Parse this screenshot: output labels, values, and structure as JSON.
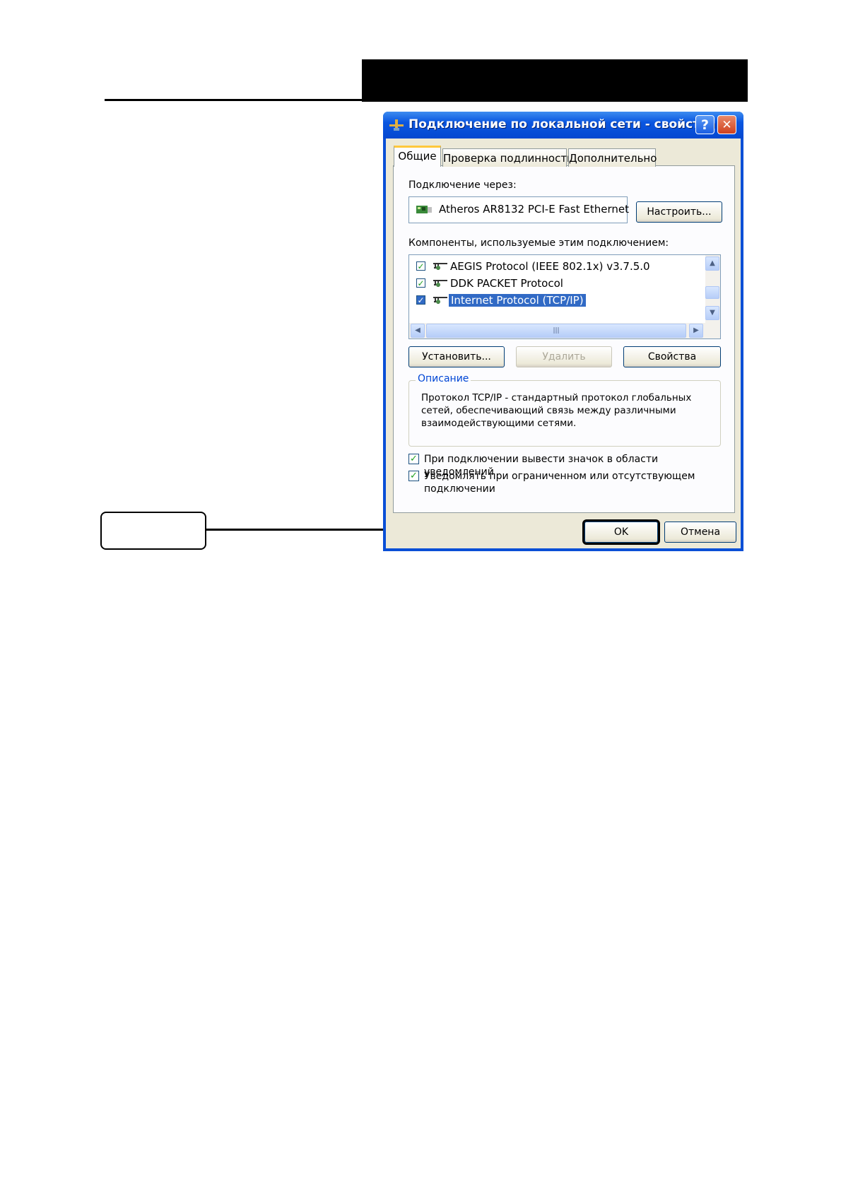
{
  "window": {
    "title": "Подключение по локальной сети - свойства",
    "help_label": "?",
    "close_label": "✕"
  },
  "tabs": [
    {
      "label": "Общие",
      "active": true
    },
    {
      "label": "Проверка подлинности",
      "active": false
    },
    {
      "label": "Дополнительно",
      "active": false
    }
  ],
  "connect_via": {
    "label": "Подключение через:",
    "adapter": "Atheros AR8132 PCI-E Fast Ethernet",
    "configure_button": "Настроить..."
  },
  "components": {
    "label": "Компоненты, используемые этим подключением:",
    "items": [
      {
        "label": "AEGIS Protocol (IEEE 802.1x) v3.7.5.0",
        "checked": true
      },
      {
        "label": "DDK PACKET Protocol",
        "checked": true
      },
      {
        "label": "Internet Protocol (TCP/IP)",
        "checked": true,
        "selected": true
      }
    ],
    "scroll_grip": "|||"
  },
  "buttons": {
    "install": "Установить...",
    "remove": "Удалить",
    "properties": "Свойства",
    "ok": "OK",
    "cancel": "Отмена"
  },
  "description": {
    "title": "Описание",
    "text": "Протокол TCP/IP - стандартный протокол глобальных сетей, обеспечивающий связь между различными взаимодействующими сетями."
  },
  "options": [
    {
      "label": "При подключении вывести значок в области уведомлений",
      "checked": true
    },
    {
      "label": "Уведомлять при ограниченном или отсутствующем подключении",
      "checked": true
    }
  ]
}
